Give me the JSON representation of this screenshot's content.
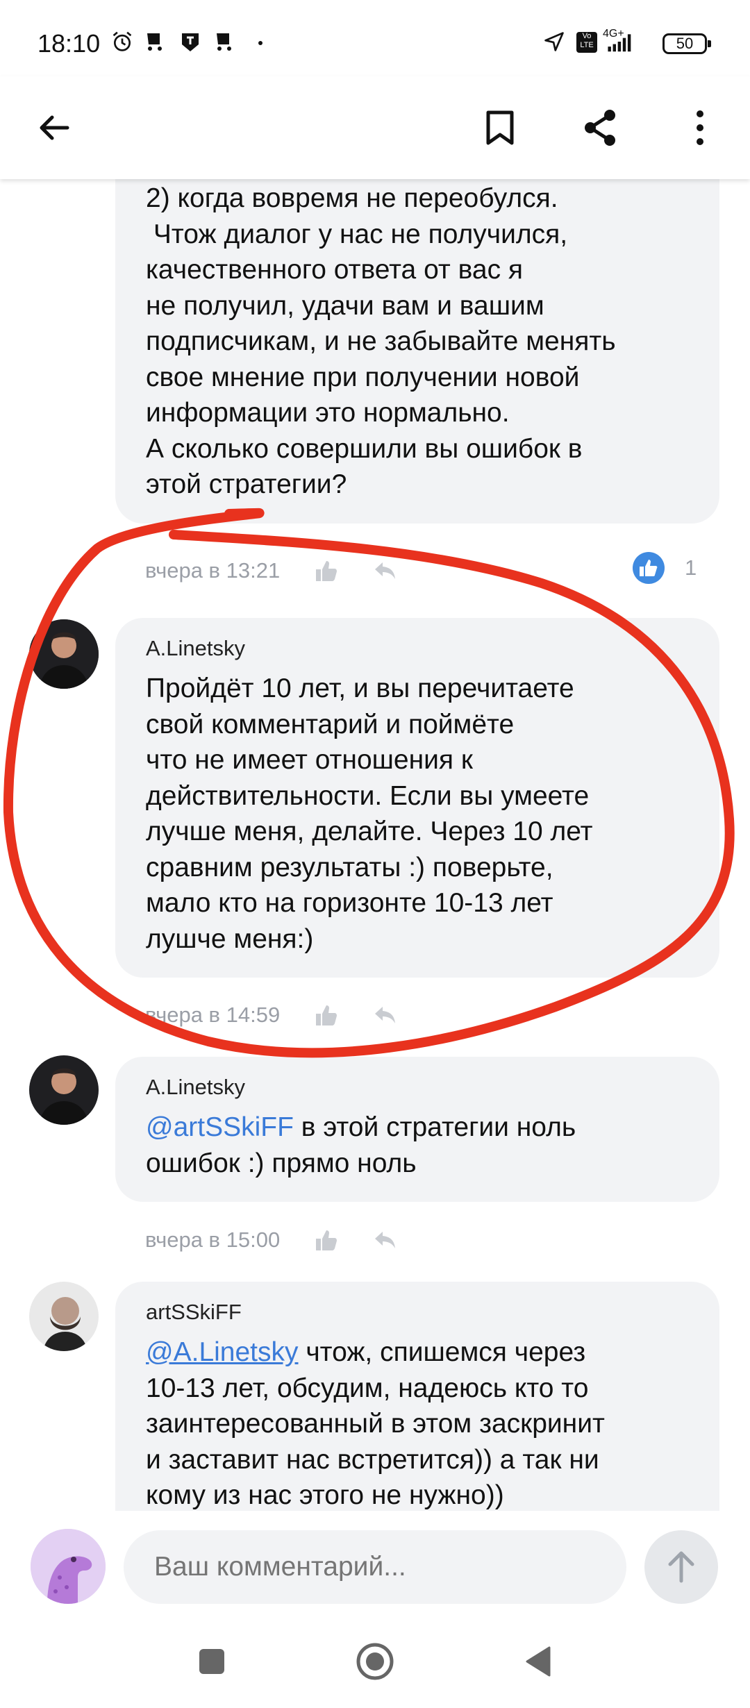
{
  "status_bar": {
    "time": "18:10",
    "network": "4G+",
    "volte": "Vo LTE",
    "battery": "50"
  },
  "app_bar": {
    "back_icon": "arrow-left-icon",
    "bookmark_icon": "bookmark-icon",
    "share_icon": "share-icon",
    "more_icon": "more-vertical-icon"
  },
  "comments": [
    {
      "author": "",
      "text": "2) когда вовремя не переобулся.\n Чтож диалог у нас не получился,\nкачественного ответа от вас я\nне получил, удачи вам и вашим\nподписчикам, и не забывайте менять\nсвое мнение при получении новой\nинформации это нормально.\nА сколько совершили вы ошибок в\nэтой стратегии?",
      "time": "вчера в 13:21",
      "likes": "1"
    },
    {
      "author": "A.Linetsky",
      "text": "Пройдёт 10 лет, и вы перечитаете\nсвой комментарий и поймёте\nчто не имеет отношения к\nдействительности. Если вы умеете\nлучше меня, делайте. Через 10 лет\nсравним результаты :) поверьте,\nмало кто на горизонте 10-13 лет\nлушче меня:)",
      "time": "вчера в 14:59"
    },
    {
      "author": "A.Linetsky",
      "mention": "@artSSkiFF",
      "text": " в этой стратегии ноль\nошибок :) прямо ноль",
      "time": "вчера в 15:00"
    },
    {
      "author": "artSSkiFF",
      "mention": "@A.Linetsky",
      "text": " чтож, спишемся через\n10-13 лет, обсудим, надеюсь кто то\nзаинтересованный в этом заскринит\nи заставит нас встретится)) а так ни\nкому из нас этого не нужно))"
    }
  ],
  "input": {
    "placeholder": "Ваш комментарий..."
  },
  "colors": {
    "mention": "#3a7ad8",
    "like_badge": "#3f8ae0",
    "annotation": "#e8321e",
    "bubble_bg": "#f2f3f5"
  }
}
